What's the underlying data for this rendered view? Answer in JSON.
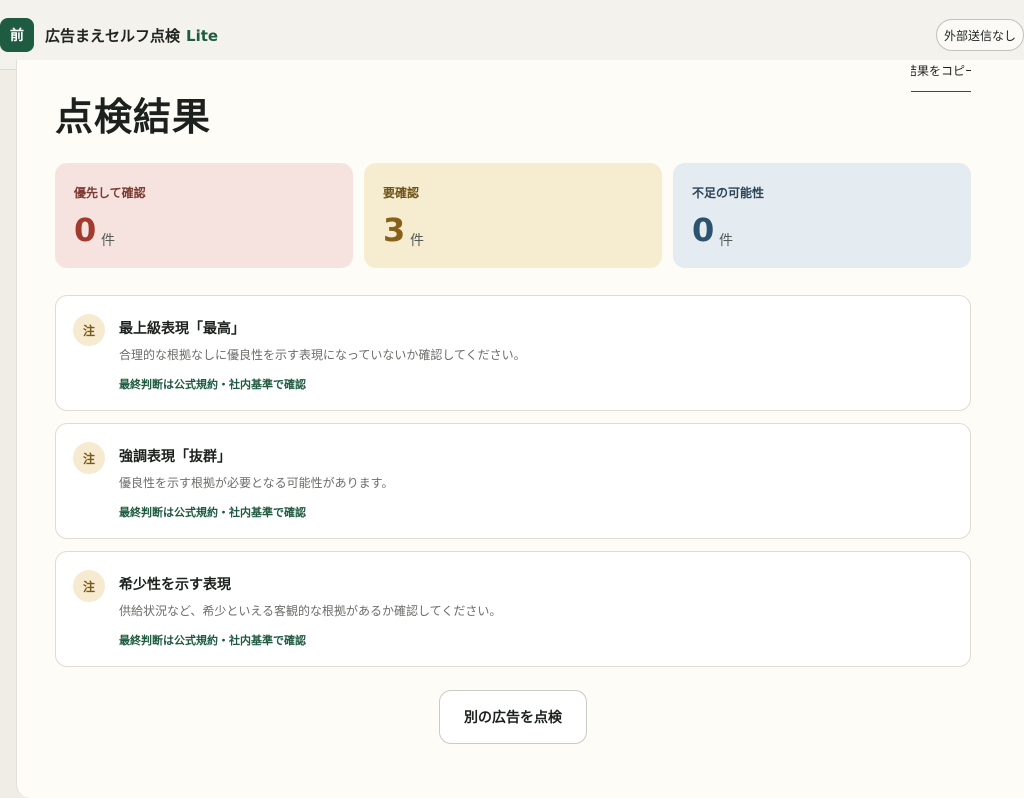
{
  "header": {
    "logo_char": "前",
    "app_name": "広告まえセルフ点検",
    "edition": "Lite",
    "privacy_badge": "外部送信なし"
  },
  "main": {
    "copy_link": "結果をコピー",
    "title": "点検結果",
    "summary": [
      {
        "label": "優先して確認",
        "count": "0",
        "unit": "件"
      },
      {
        "label": "要確認",
        "count": "3",
        "unit": "件"
      },
      {
        "label": "不足の可能性",
        "count": "0",
        "unit": "件"
      }
    ],
    "findings": [
      {
        "icon_char": "注",
        "title": "最上級表現「最高」",
        "description": "合理的な根拠なしに優良性を示す表現になっていないか確認してください。",
        "note": "最終判断は公式規約・社内基準で確認"
      },
      {
        "icon_char": "注",
        "title": "強調表現「抜群」",
        "description": "優良性を示す根拠が必要となる可能性があります。",
        "note": "最終判断は公式規約・社内基準で確認"
      },
      {
        "icon_char": "注",
        "title": "希少性を示す表現",
        "description": "供給状況など、希少といえる客観的な根拠があるか確認してください。",
        "note": "最終判断は公式規約・社内基準で確認"
      }
    ],
    "action_button": "別の広告を点検"
  },
  "colors": {
    "brand": "#1e5b40",
    "priority_bg": "#f6e3e0",
    "review_bg": "#f6ecd0",
    "missing_bg": "#e4ebf1",
    "notice_icon_bg": "#f6ead0"
  }
}
